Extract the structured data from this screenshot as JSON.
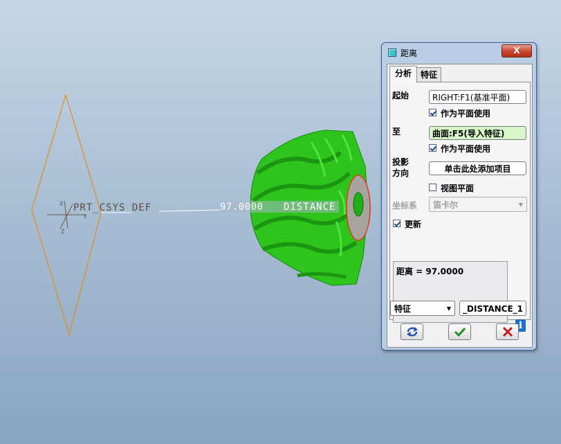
{
  "viewport": {
    "csys_label": "PRT_CSYS_DEF",
    "csys_axis_x": "X",
    "csys_axis_z": "Z",
    "csys_axis_x2": "X",
    "measure_value": "97.0000",
    "measure_name": "DISTANCE",
    "colors": {
      "plane": "#e58a1a",
      "gear": "#2ec41b",
      "hub": "#a7a4a0",
      "hub_edge": "#e03a1a"
    }
  },
  "dialog": {
    "title": "距离",
    "close_label": "X",
    "tabs": [
      {
        "label": "分析"
      },
      {
        "label": "特征"
      }
    ],
    "from_label": "起始",
    "from_value": "RIGHT:F1(基准平面)",
    "from_use_as_plane": "作为平面使用",
    "to_label": "至",
    "to_value": "曲面:F5(导入特征)",
    "to_use_as_plane": "作为平面使用",
    "projection_label_line1": "投影",
    "projection_label_line2": "方向",
    "projection_value": "单击此处添加项目",
    "view_plane_label": "视图平面",
    "csys_type_label": "坐标系",
    "csys_type_value": "笛卡尔",
    "update_label": "更新",
    "result_text": "距离 = 97.0000",
    "feature_type": "特征",
    "feature_name": "_DISTANCE_1"
  }
}
